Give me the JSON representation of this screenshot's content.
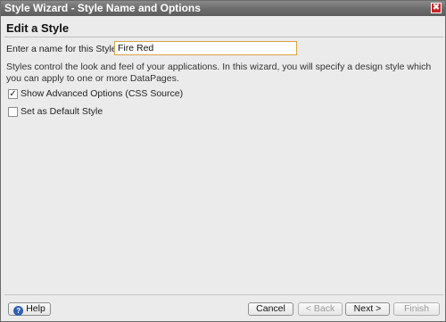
{
  "window": {
    "title": "Style Wizard - Style Name and Options",
    "close_glyph": "✖"
  },
  "heading": "Edit a Style",
  "name_field": {
    "label": "Enter a name for this Style:",
    "value": "Fire Red"
  },
  "description": "Styles control the look and feel of your applications. In this wizard, you will specify a design style which you can apply to one or more DataPages.",
  "options": [
    {
      "label": "Show Advanced Options (CSS Source)",
      "checked": true,
      "glyph": "✓"
    },
    {
      "label": "Set as Default Style",
      "checked": false,
      "glyph": ""
    }
  ],
  "buttons": {
    "help": "Help",
    "help_icon": "?",
    "cancel": "Cancel",
    "back": "< Back",
    "next": "Next >",
    "finish": "Finish"
  },
  "colors": {
    "titlebar": "#6d6d6d",
    "close_button": "#c4282a",
    "input_border": "#d8a24a",
    "help_icon": "#2f5fb0"
  }
}
